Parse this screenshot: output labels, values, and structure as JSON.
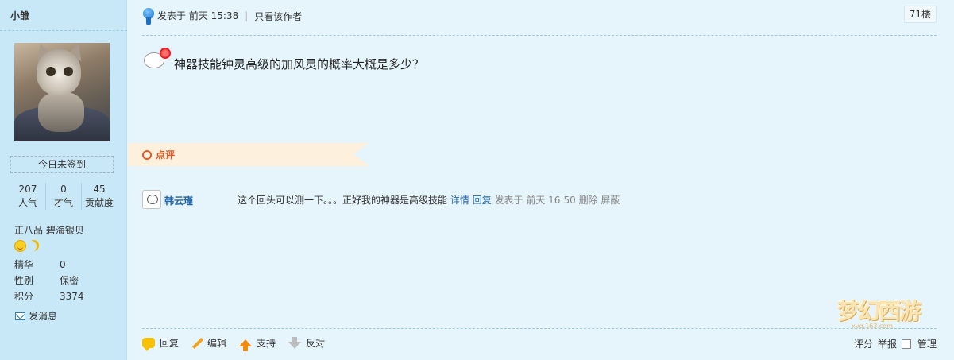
{
  "sidebar": {
    "username": "小雏",
    "checkin_label": "今日未签到",
    "stats": [
      {
        "value": "207",
        "label": "人气"
      },
      {
        "value": "0",
        "label": "才气"
      },
      {
        "value": "45",
        "label": "贡献度"
      }
    ],
    "rank": "正八品 碧海银贝",
    "profile": [
      {
        "key": "精华",
        "value": "0"
      },
      {
        "key": "性别",
        "value": "保密"
      },
      {
        "key": "积分",
        "value": "3374"
      }
    ],
    "send_message": "发消息"
  },
  "post": {
    "posted_on": "发表于 前天 15:38",
    "only_author": "只看该作者",
    "floor": "71楼",
    "content": "神器技能钟灵高级的加风灵的概率大概是多少？"
  },
  "rating": {
    "label": "点评"
  },
  "comment": {
    "author": "韩云瑾",
    "text": "这个回头可以测一下。。。正好我的神器是高级技能",
    "details": "详情",
    "reply": "回复",
    "posted_on": "发表于 前天 16:50",
    "delete": "删除",
    "block": "屏蔽"
  },
  "actions": {
    "reply": "回复",
    "edit": "编辑",
    "support": "支持",
    "oppose": "反对",
    "rate": "评分",
    "report": "举报",
    "manage": "管理"
  },
  "watermark": {
    "text": "梦幻西游",
    "sub": "xyq.163.com"
  }
}
